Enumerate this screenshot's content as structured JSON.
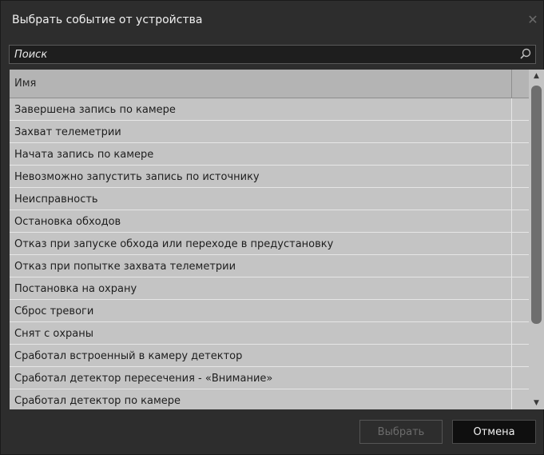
{
  "dialog": {
    "title": "Выбрать событие от устройства",
    "close_icon": "close-icon"
  },
  "search": {
    "placeholder": "Поиск",
    "icon": "search-icon"
  },
  "table": {
    "column_header": "Имя",
    "rows": [
      "Завершена запись по камере",
      "Захват телеметрии",
      "Начата запись по камере",
      "Невозможно запустить запись по источнику",
      "Неисправность",
      "Остановка обходов",
      "Отказ при запуске обхода или переходе в предустановку",
      "Отказ при попытке захвата телеметрии",
      "Постановка на охрану",
      "Сброс тревоги",
      "Снят с охраны",
      "Сработал встроенный в камеру детектор",
      "Сработал детектор пересечения - «Внимание»",
      "Сработал детектор по камере"
    ]
  },
  "footer": {
    "select_label": "Выбрать",
    "cancel_label": "Отмена"
  },
  "colors": {
    "dialog_bg": "#2d2d2d",
    "table_bg": "#c4c4c4",
    "header_bg": "#b4b4b4",
    "disabled_text": "#6c6c6c",
    "cancel_bg": "#0f0f0f"
  }
}
